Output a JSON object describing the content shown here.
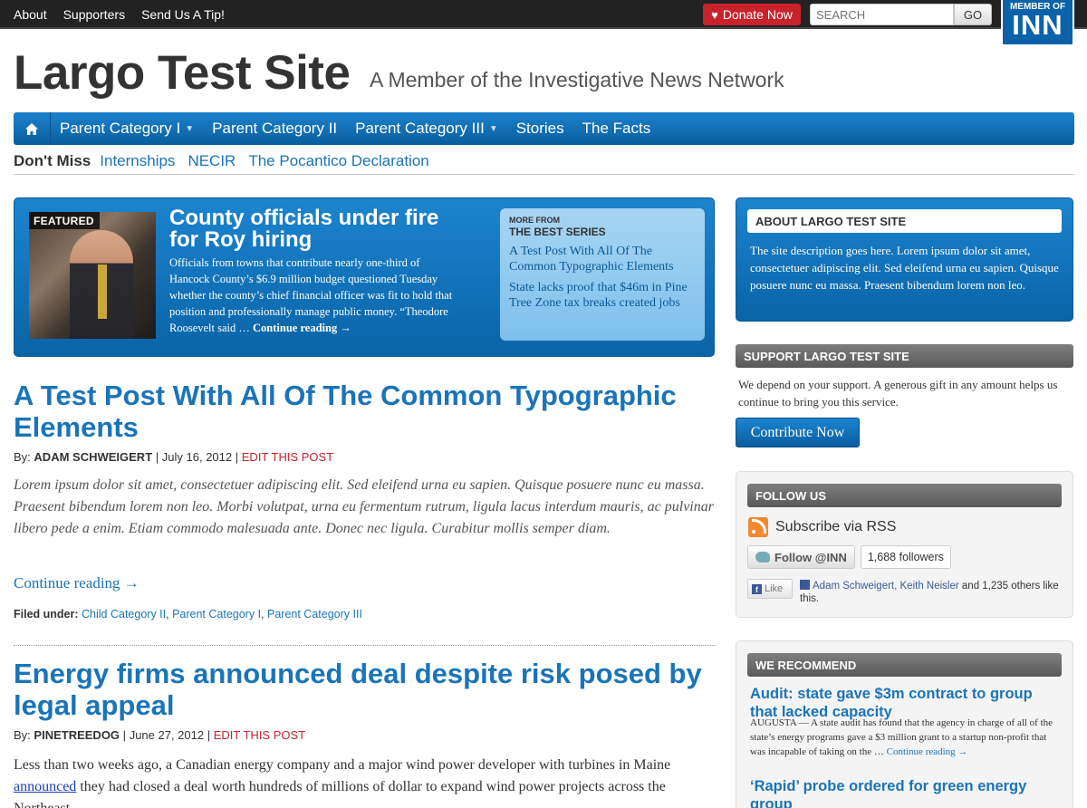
{
  "topbar": {
    "links": [
      "About",
      "Supporters",
      "Send Us A Tip!"
    ],
    "donate_label": "Donate Now",
    "search_placeholder": "SEARCH",
    "go_label": "GO",
    "inn_small": "MEMBER OF",
    "inn_big": "INN"
  },
  "masthead": {
    "title": "Largo Test Site",
    "tagline": "A Member of the Investigative News Network"
  },
  "nav": {
    "items": [
      {
        "label": "Parent Category I",
        "dropdown": true
      },
      {
        "label": "Parent Category II",
        "dropdown": false
      },
      {
        "label": "Parent Category III",
        "dropdown": true
      },
      {
        "label": "Stories",
        "dropdown": false
      },
      {
        "label": "The Facts",
        "dropdown": false
      }
    ]
  },
  "dont_miss": {
    "label": "Don't Miss",
    "links": [
      "Internships",
      "NECIR",
      "The Pocantico Declaration"
    ]
  },
  "featured": {
    "label": "FEATURED",
    "title": "County officials under fire for Roy hiring",
    "body": "Officials from towns that contribute nearly one-third of Hancock County’s $6.9 million budget questioned Tuesday whether the county’s chief financial officer was fit to hold that position and professionally manage public money. “Theodore Roosevelt said …",
    "continue": "Continue reading →",
    "more_kicker": "MORE FROM",
    "more_title": "THE BEST SERIES",
    "more_links": [
      "A Test Post With All Of The Common Typographic Elements",
      "State lacks proof that $46m in Pine Tree Zone tax breaks created jobs"
    ]
  },
  "posts": [
    {
      "title": "A Test Post With All Of The Common Typographic Elements",
      "by": "By:",
      "author": "ADAM SCHWEIGERT",
      "date": "July 16, 2012",
      "edit": "EDIT THIS POST",
      "excerpt": "Lorem ipsum dolor sit amet, consectetuer adipiscing elit. Sed eleifend urna eu sapien. Quisque posuere nunc eu massa. Praesent bibendum lorem non leo. Morbi volutpat, urna eu fermentum rutrum, ligula lacus interdum mauris, ac pulvinar libero pede a enim. Etiam commodo malesuada ante. Donec nec ligula. Curabitur mollis semper diam.",
      "continue": "Continue reading →",
      "filed_label": "Filed under:",
      "categories": [
        "Child Category II",
        "Parent Category I",
        "Parent Category III"
      ]
    },
    {
      "title": "Energy firms announced deal despite risk posed by legal appeal",
      "by": "By:",
      "author": "PINETREEDOG",
      "date": "June 27, 2012",
      "edit": "EDIT THIS POST",
      "body_before": "Less than two weeks ago, a Canadian energy company and a major wind power developer with turbines in Maine",
      "body_link": "announced",
      "body_after": "they had closed a deal worth hundreds of millions of dollar to expand wind power projects across the Northeast."
    }
  ],
  "sidebar": {
    "about_title": "ABOUT LARGO TEST SITE",
    "about_text": "The site description goes here. Lorem ipsum dolor sit amet, consectetuer adipiscing elit. Sed eleifend urna eu sapien. Quisque posuere nunc eu massa. Praesent bibendum lorem non leo.",
    "support_title": "SUPPORT LARGO TEST SITE",
    "support_text": "We depend on your support. A generous gift in any amount helps us continue to bring you this service.",
    "contribute_label": "Contribute Now",
    "follow_title": "FOLLOW US",
    "rss_label": "Subscribe via RSS",
    "twitter_label": "Follow @INN",
    "twitter_count": "1,688 followers",
    "fb_like": "Like",
    "fb_names": "Adam Schweigert, Keith Neisler",
    "fb_rest": " and 1,235 others like this.",
    "recommend_title": "WE RECOMMEND",
    "rec1_title": "Audit: state gave $3m contract to group that lacked capacity",
    "rec1_body": "AUGUSTA — A state audit has found that the agency in charge of all of the state’s energy programs gave a $3 million grant to a startup non-profit that was incapable of taking on the …",
    "rec1_continue": "Continue reading →",
    "rec2_title": "‘Rapid’ probe ordered for green energy group"
  },
  "colors": {
    "brand_blue": "#0b62a8",
    "link_blue": "#1a74b8",
    "donate_red": "#c8222a",
    "topbar": "#222222"
  }
}
